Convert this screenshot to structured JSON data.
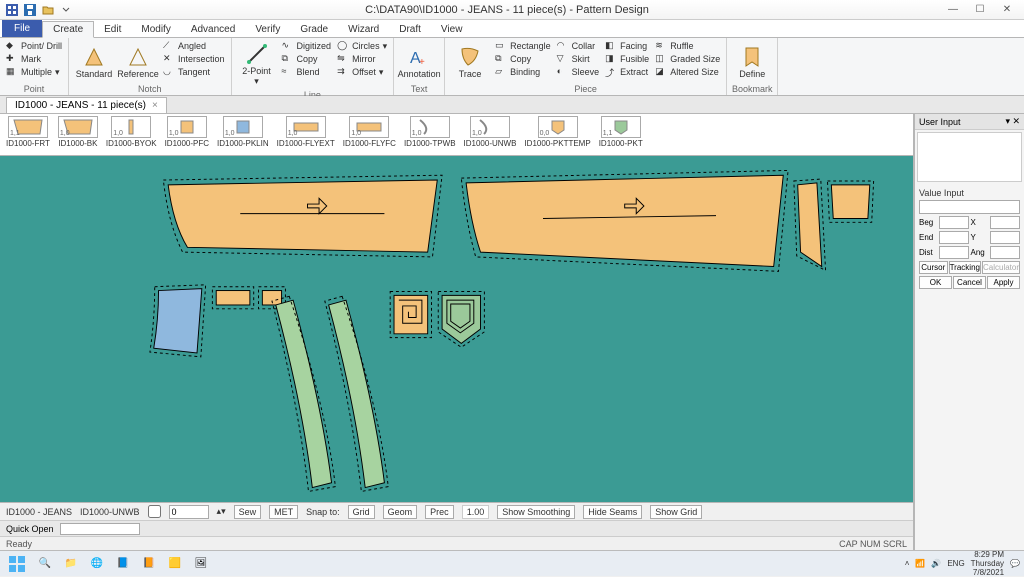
{
  "title": "C:\\DATA90\\ID1000 - JEANS - 11 piece(s) - Pattern Design",
  "ribbon_tabs": {
    "file": "File",
    "items": [
      "Create",
      "Edit",
      "Modify",
      "Advanced",
      "Verify",
      "Grade",
      "Wizard",
      "Draft",
      "View"
    ],
    "active": 0
  },
  "ribbon": {
    "point": {
      "label": "Point",
      "items": [
        "Point/ Drill",
        "Mark",
        "Multiple"
      ]
    },
    "notch": {
      "label": "Notch",
      "standard": "Standard",
      "reference": "Reference",
      "angled": "Angled",
      "intersection": "Intersection",
      "tangent": "Tangent"
    },
    "line": {
      "label": "Line",
      "twopoint": "2-Point",
      "digitized": "Digitized",
      "copy": "Copy",
      "blend": "Blend",
      "circles": "Circles",
      "mirror": "Mirror",
      "offset": "Offset"
    },
    "text": {
      "label": "Text",
      "annotation": "Annotation"
    },
    "piece": {
      "label": "Piece",
      "trace": "Trace",
      "rectangle": "Rectangle",
      "copy": "Copy",
      "binding": "Binding",
      "collar": "Collar",
      "skirt": "Skirt",
      "sleeve": "Sleeve",
      "facing": "Facing",
      "fusible": "Fusible",
      "extract": "Extract",
      "ruffle": "Ruffle",
      "graded": "Graded Size",
      "altered": "Altered Size"
    },
    "bookmark": {
      "label": "Bookmark",
      "define": "Define"
    }
  },
  "doc_tab": {
    "label": "ID1000 - JEANS - 11 piece(s)"
  },
  "thumbs": [
    {
      "name": "ID1000-FRT",
      "val": "1,1",
      "fill": "#f4c27a",
      "shape": "trap"
    },
    {
      "name": "ID1000-BK",
      "val": "1,0",
      "fill": "#f4c27a",
      "shape": "trap"
    },
    {
      "name": "ID1000-BYOK",
      "val": "1,0",
      "fill": "#f4c27a",
      "shape": "bar"
    },
    {
      "name": "ID1000-PFC",
      "val": "1,0",
      "fill": "#f4c27a",
      "shape": "sq"
    },
    {
      "name": "ID1000-PKLIN",
      "val": "1,0",
      "fill": "#8fb8de",
      "shape": "sq"
    },
    {
      "name": "ID1000-FLYEXT",
      "val": "1,0",
      "fill": "#f4c27a",
      "shape": "wide"
    },
    {
      "name": "ID1000-FLYFC",
      "val": "1,0",
      "fill": "#f4c27a",
      "shape": "wide"
    },
    {
      "name": "ID1000-TPWB",
      "val": "1,0",
      "fill": "none",
      "shape": "curve"
    },
    {
      "name": "ID1000-UNWB",
      "val": "1,0",
      "fill": "none",
      "shape": "curve"
    },
    {
      "name": "ID1000-PKTTEMP",
      "val": "0,0",
      "fill": "#f4c27a",
      "shape": "pkt"
    },
    {
      "name": "ID1000-PKT",
      "val": "1,1",
      "fill": "#9bc99a",
      "shape": "pkt"
    }
  ],
  "status": {
    "style": "ID1000 - JEANS",
    "piece": "ID1000-UNWB",
    "spin": "0",
    "sew": "Sew",
    "met": "MET",
    "snapto": "Snap to:",
    "grid": "Grid",
    "geom": "Geom",
    "prec": "Prec",
    "precval": "1.00",
    "smooth": "Show Smoothing",
    "hideseams": "Hide Seams",
    "showgrid": "Show Grid"
  },
  "quickopen": {
    "label": "Quick Open"
  },
  "appstatus": {
    "ready": "Ready",
    "caps": "CAP  NUM  SCRL"
  },
  "rightpanel": {
    "title": "User Input",
    "valueinput": "Value Input",
    "beg": "Beg",
    "end": "End",
    "dist": "Dist",
    "x": "X",
    "y": "Y",
    "ang": "Ang",
    "cursor": "Cursor",
    "tracking": "Tracking",
    "calculator": "Calculator",
    "ok": "OK",
    "cancel": "Cancel",
    "apply": "Apply"
  },
  "tray": {
    "lang": "ENG",
    "time": "8:29 PM",
    "day": "Thursday",
    "date": "7/8/2021"
  }
}
